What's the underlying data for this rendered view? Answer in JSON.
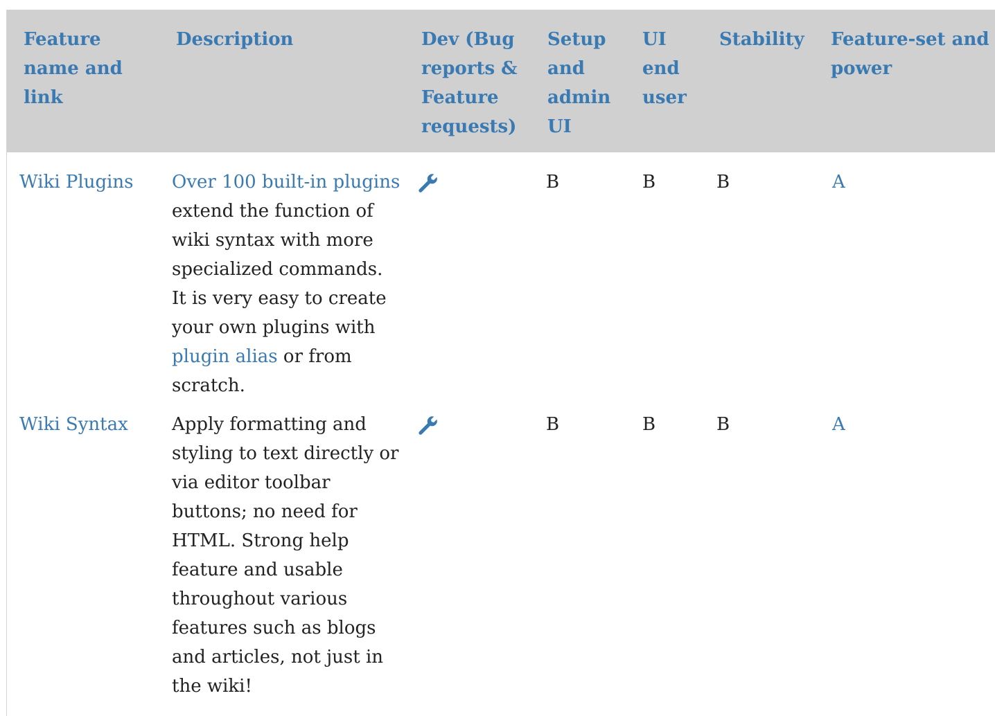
{
  "table": {
    "headers": [
      "Feature name and link",
      "Description",
      "Dev (Bug reports & Feature requests)",
      "Setup and admin UI",
      "UI end user",
      "Stability",
      "Feature-set and power"
    ],
    "rows": [
      {
        "feature": "Wiki Plugins",
        "description": {
          "link1": "Over 100 built-in plugins",
          "text1": " extend the function of wiki syntax with more specialized commands. It is very easy to create your own plugins with ",
          "link2": "plugin alias",
          "text2": " or from scratch."
        },
        "dev_icon": "wrench-icon",
        "setup": "B",
        "ui": "B",
        "stability": "B",
        "power": "A"
      },
      {
        "feature": "Wiki Syntax",
        "description": {
          "text1": "Apply formatting and styling to text directly or via editor toolbar buttons; no need for HTML. Strong help feature and usable throughout various features such as blogs and articles, not just in the wiki!"
        },
        "dev_icon": "wrench-icon",
        "setup": "B",
        "ui": "B",
        "stability": "B",
        "power": "A"
      }
    ]
  },
  "colors": {
    "header_background": "#d0d0d0",
    "link": "#3a7ab3",
    "text": "#222222"
  }
}
